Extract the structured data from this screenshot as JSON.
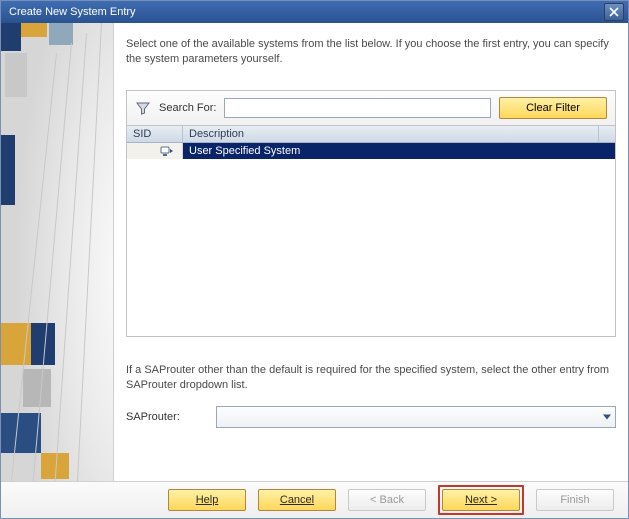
{
  "window": {
    "title": "Create New System Entry"
  },
  "intro": "Select one of the available systems from the list below. If you choose the first entry, you can specify the system parameters yourself.",
  "search": {
    "label": "Search For:",
    "value": "",
    "clear_label": "Clear Filter"
  },
  "table": {
    "headers": {
      "sid": "SID",
      "description": "Description"
    },
    "rows": [
      {
        "sid": "",
        "description": "User Specified System",
        "selected": true
      }
    ]
  },
  "saprouter": {
    "hint": "If a SAProuter other than the default is required for the specified system, select the other entry from SAProuter dropdown list.",
    "label": "SAProuter:",
    "value": ""
  },
  "footer": {
    "help": "Help",
    "cancel": "Cancel",
    "back": "< Back",
    "next": "Next >",
    "finish": "Finish"
  }
}
